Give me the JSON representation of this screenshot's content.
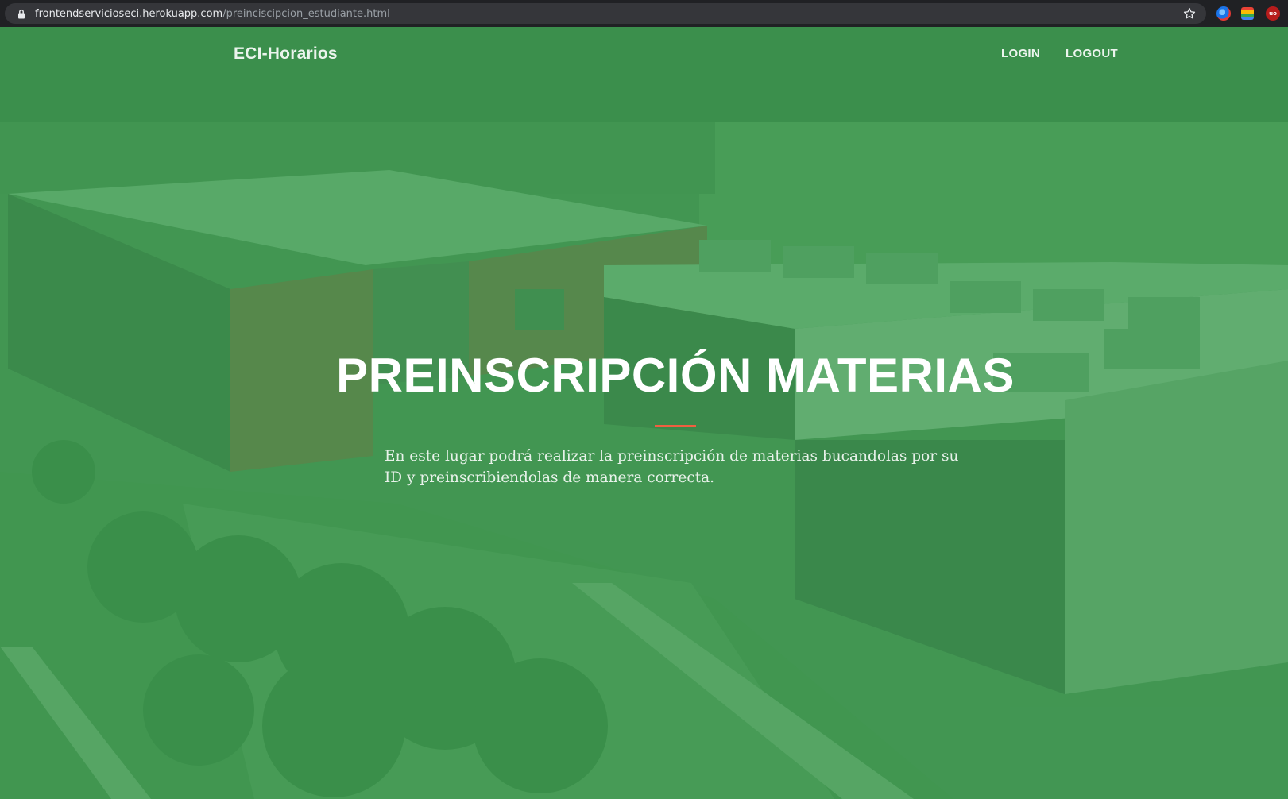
{
  "browser": {
    "url_host": "frontendservicioseci.herokuapp.com",
    "url_path": "/preinciscipcion_estudiante.html",
    "extensions": [
      "chrome-icon",
      "google-apps-icon",
      "ublock-icon"
    ],
    "ublock_label": "uo"
  },
  "navbar": {
    "brand": "ECI-Horarios",
    "links": [
      "LOGIN",
      "LOGOUT"
    ]
  },
  "hero": {
    "title": "PREINSCRIPCIÓN MATERIAS",
    "description": "En este lugar podrá realizar la preinscripción de materias bucandolas por su ID y preinscribiendolas de manera correcta.",
    "divider_color": "#f05f40",
    "overlay_color": "#46a05a"
  }
}
